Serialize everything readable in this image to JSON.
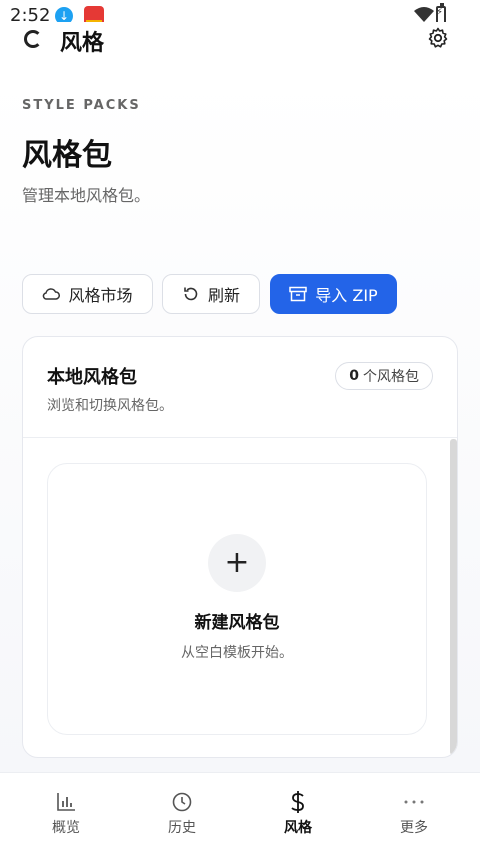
{
  "status_bar": {
    "time": "2:52"
  },
  "app_bar": {
    "title": "风格"
  },
  "header": {
    "kicker": "STYLE PACKS",
    "title": "风格包",
    "subtitle": "管理本地风格包。"
  },
  "actions": {
    "market_label": "风格市场",
    "refresh_label": "刷新",
    "import_label": "导入 ZIP"
  },
  "local_packs": {
    "title": "本地风格包",
    "subtitle": "浏览和切换风格包。",
    "count": "0",
    "count_unit": "个风格包"
  },
  "new_pack": {
    "plus": "+",
    "title": "新建风格包",
    "subtitle": "从空白模板开始。"
  },
  "bottom_nav": {
    "items": [
      {
        "label": "概览",
        "icon": "bar-chart-icon"
      },
      {
        "label": "历史",
        "icon": "clock-icon"
      },
      {
        "label": "风格",
        "icon": "dollar-icon",
        "active": true
      },
      {
        "label": "更多",
        "icon": "more-icon"
      }
    ]
  },
  "colors": {
    "primary": "#2364e8"
  }
}
